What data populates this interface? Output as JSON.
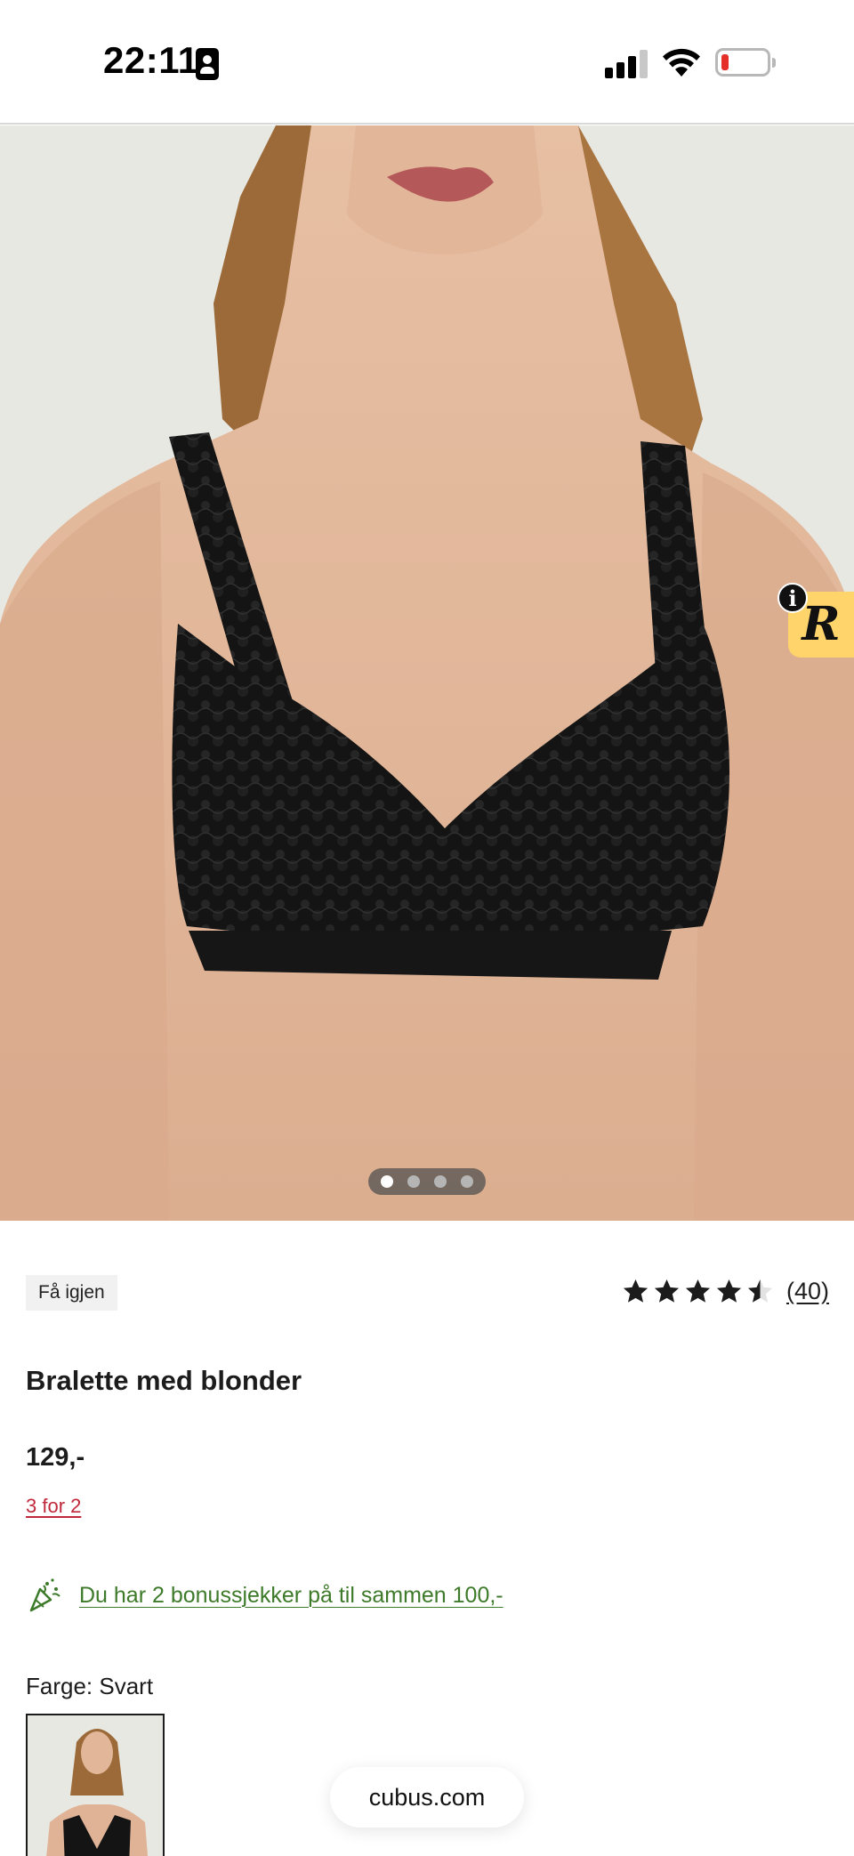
{
  "status_bar": {
    "time": "22:11",
    "icons": [
      "contact-card-icon",
      "cellular-signal-icon",
      "wifi-icon",
      "battery-low-icon"
    ],
    "battery_color": "#e5302a"
  },
  "product_gallery": {
    "image": "product-photo-black-lace-bralette",
    "slide_count": 4,
    "active_slide": 1
  },
  "widget": {
    "icon": "r-logo-icon",
    "letter": "R",
    "info_glyph": "i",
    "color": "#ffd56b"
  },
  "product": {
    "badge": "Få igjen",
    "rating_value": 4.5,
    "rating_max": 5,
    "rating_count": "(40)",
    "title": "Bralette med blonder",
    "price": "129,-",
    "promo": "3 for 2",
    "promo_color": "#c0283b",
    "bonus_text": "Du har 2 bonussjekker på til sammen 100,-",
    "bonus_color": "#3d7a2a",
    "color_label": "Farge: Svart"
  },
  "browser": {
    "domain": "cubus.com"
  }
}
